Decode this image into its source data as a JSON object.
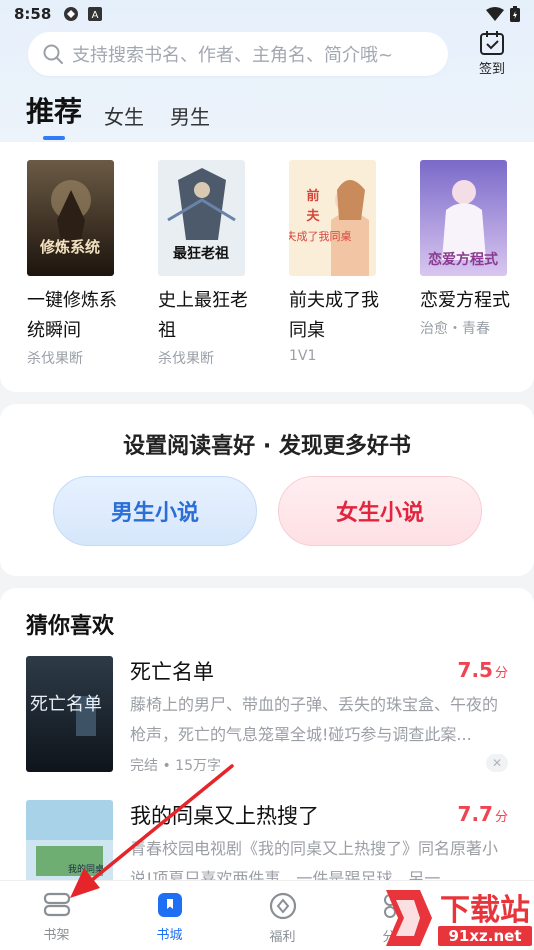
{
  "status_bar": {
    "time": "8:58"
  },
  "search": {
    "placeholder": "支持搜索书名、作者、主角名、简介哦~"
  },
  "checkin": {
    "label": "签到"
  },
  "tabs": [
    {
      "label": "推荐",
      "active": true
    },
    {
      "label": "女生",
      "active": false
    },
    {
      "label": "男生",
      "active": false
    }
  ],
  "recommend": [
    {
      "title": "一键修炼系统瞬间",
      "tag": "杀伐果断",
      "cover_text": "修炼系统"
    },
    {
      "title": "史上最狂老祖",
      "tag": "杀伐果断",
      "cover_text": "最狂老祖"
    },
    {
      "title": "前夫成了我同桌",
      "tag": "1V1",
      "cover_text": "前夫成了我同桌"
    },
    {
      "title": "恋爱方程式",
      "tag": "治愈・青春",
      "cover_text": "恋爱方程式"
    }
  ],
  "preference": {
    "title": "设置阅读喜好 · 发现更多好书",
    "male_button": "男生小说",
    "female_button": "女生小说"
  },
  "guess": {
    "title": "猜你喜欢",
    "items": [
      {
        "name": "死亡名单",
        "score": "7.5",
        "score_unit": "分",
        "desc": "藤椅上的男尸、带血的子弹、丢失的珠宝盒、午夜的枪声，死亡的气息笼罩全城!碰巧参与调查此案...",
        "meta": "完结 • 15万字",
        "cover_text": "死亡名单"
      },
      {
        "name": "我的同桌又上热搜了",
        "score": "7.7",
        "score_unit": "分",
        "desc": "青春校园电视剧《我的同桌又上热搜了》同名原著小说!项夏只喜欢两件事，一件是踢足球，另一...",
        "meta": "",
        "cover_text": "我的同桌"
      }
    ]
  },
  "bottom_nav": [
    {
      "label": "书架",
      "icon": "bookshelf-icon",
      "active": false
    },
    {
      "label": "书城",
      "icon": "bookstore-icon",
      "active": true
    },
    {
      "label": "福利",
      "icon": "welfare-icon",
      "active": false
    },
    {
      "label": "分类",
      "icon": "category-icon",
      "active": false
    }
  ],
  "watermark": {
    "text": "下载站",
    "url_text": "91xz.net"
  },
  "colors": {
    "accent": "#1f6ff2",
    "score": "#ef4452",
    "female": "#e0253f",
    "male": "#2a6ed6"
  }
}
